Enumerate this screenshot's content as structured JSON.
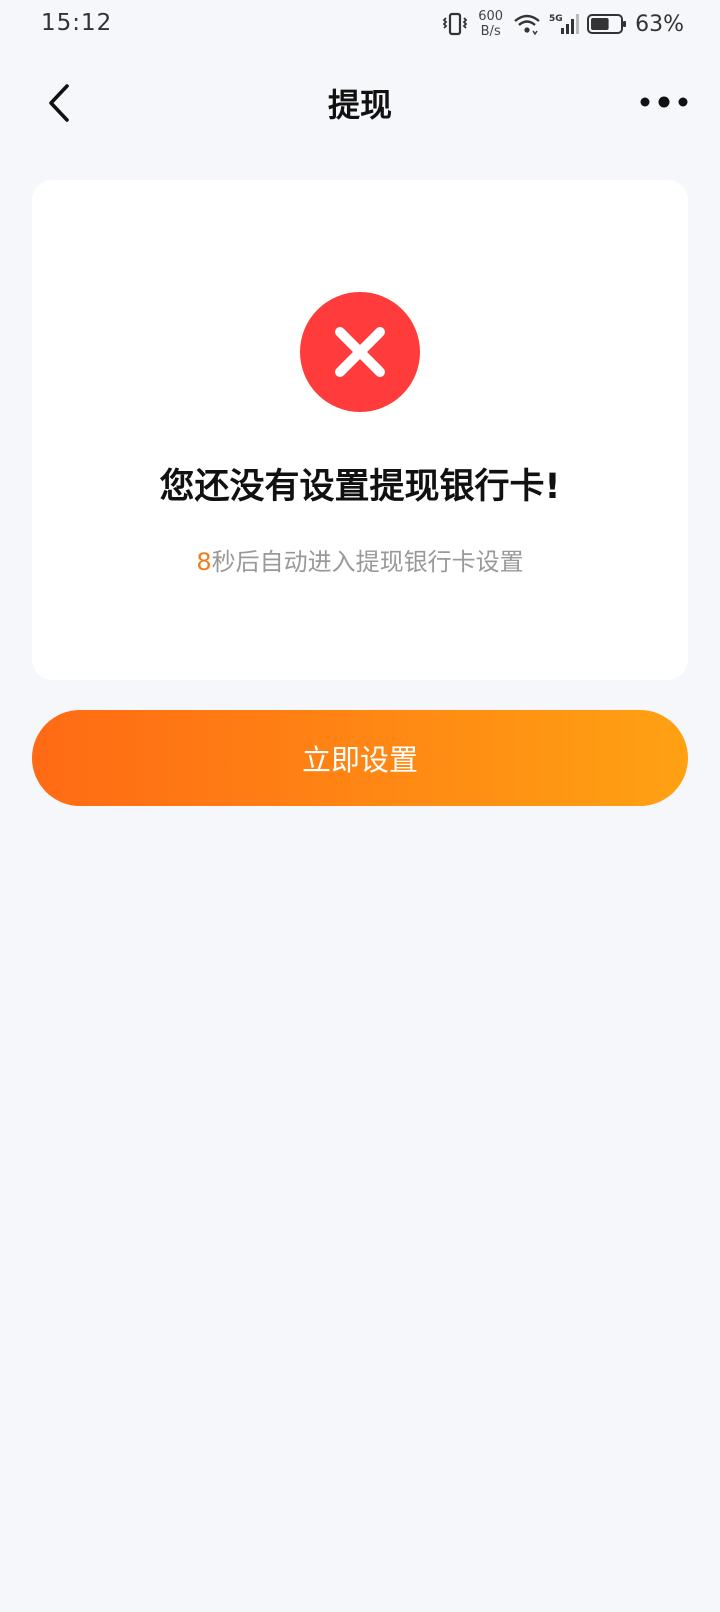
{
  "status_bar": {
    "time": "15:12",
    "net_speed_value": "600",
    "net_speed_unit": "B/s",
    "network_type": "5G",
    "battery_percent": "63%",
    "battery_level": 0.63
  },
  "nav": {
    "title": "提现",
    "back_icon": "chevron-left-icon",
    "more_icon": "more-dots-icon"
  },
  "card": {
    "icon": "error-x-icon",
    "icon_color": "#ff3b3b",
    "title": "您还没有设置提现银行卡!",
    "countdown": "8",
    "countdown_color": "#f07d1b",
    "subtitle_suffix": "秒后自动进入提现银行卡设置"
  },
  "primary_button": {
    "label": "立即设置",
    "gradient_start": "#ff6a14",
    "gradient_end": "#ffa113"
  }
}
